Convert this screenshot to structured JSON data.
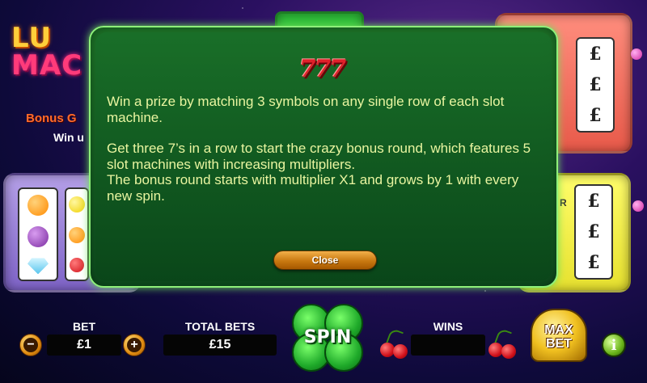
{
  "background": {
    "logo": {
      "line1": "LU",
      "line2": "MAC"
    },
    "bonus_text": "Bonus G",
    "win_text": "Win u",
    "red_machine_symbols": [
      "£",
      "£",
      "£"
    ],
    "yellow_machine_symbols": [
      "£",
      "£",
      "£"
    ],
    "yellow_machine_edge": "R"
  },
  "modal": {
    "icon_text": "777",
    "paragraph1": "Win a prize by matching 3 symbols on any single row of each slot machine.",
    "paragraph2": "Get three 7’s in a row to start the crazy bonus round, which features 5 slot machines with increasing multipliers.",
    "paragraph3": "The bonus round starts with multiplier X1 and grows by 1 with every new spin.",
    "close_label": "Close"
  },
  "bottom_bar": {
    "bet_label": "BET",
    "bet_value": "£1",
    "bet_decrease_symbol": "−",
    "bet_increase_symbol": "+",
    "total_bets_label": "TOTAL BETS",
    "total_bets_value": "£15",
    "spin_label": "SPIN",
    "wins_label": "WINS",
    "wins_value": "",
    "max_bet_label_line1": "MAX",
    "max_bet_label_line2": "BET",
    "info_symbol": "i"
  },
  "colors": {
    "modal_green": "#1f7b2a",
    "modal_text": "#e9f5a0",
    "close_button": "#c87810",
    "spin_clover": "#1faa2a"
  }
}
